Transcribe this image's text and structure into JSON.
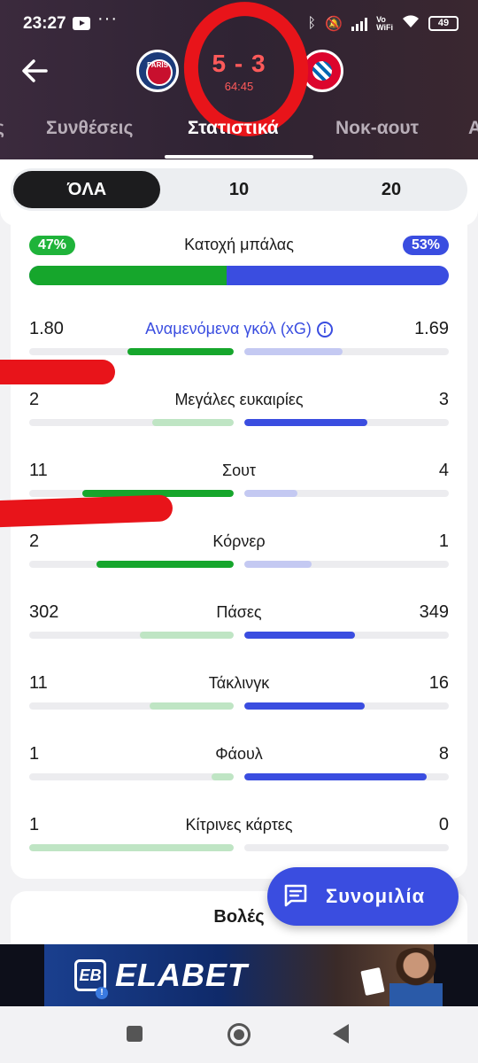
{
  "status_bar": {
    "time": "23:27",
    "volte_line1": "Vo",
    "volte_line2": "WiFi",
    "battery": "49"
  },
  "match": {
    "home_crest_text": "PARIS",
    "score": "5 - 3",
    "clock": "64:45"
  },
  "tabs": [
    {
      "label": "ς"
    },
    {
      "label": "Συνθέσεις"
    },
    {
      "label": "Στατιστικά"
    },
    {
      "label": "Νοκ-αουτ"
    },
    {
      "label": "Α"
    }
  ],
  "period_filter": {
    "options": [
      "ΌΛΑ",
      "10",
      "20"
    ],
    "selected": "ΌΛΑ"
  },
  "possession": {
    "title": "Κατοχή μπάλας",
    "home": "47%",
    "away": "53%",
    "home_fraction": 0.47
  },
  "stats": [
    {
      "label": "Αναμενόμενα γκόλ (xG)",
      "home": "1.80",
      "away": "1.69",
      "home_fill": 0.52,
      "away_fill": 0.48,
      "home_strong": true,
      "away_strong": false,
      "highlight": true
    },
    {
      "label": "Μεγάλες ευκαιρίες",
      "home": "2",
      "away": "3",
      "home_fill": 0.4,
      "away_fill": 0.6,
      "home_strong": false,
      "away_strong": true,
      "highlight": false
    },
    {
      "label": "Σουτ",
      "home": "11",
      "away": "4",
      "home_fill": 0.74,
      "away_fill": 0.26,
      "home_strong": true,
      "away_strong": false,
      "highlight": false
    },
    {
      "label": "Κόρνερ",
      "home": "2",
      "away": "1",
      "home_fill": 0.67,
      "away_fill": 0.33,
      "home_strong": true,
      "away_strong": false,
      "highlight": false
    },
    {
      "label": "Πάσες",
      "home": "302",
      "away": "349",
      "home_fill": 0.46,
      "away_fill": 0.54,
      "home_strong": false,
      "away_strong": true,
      "highlight": false
    },
    {
      "label": "Τάκλινγκ",
      "home": "11",
      "away": "16",
      "home_fill": 0.41,
      "away_fill": 0.59,
      "home_strong": false,
      "away_strong": true,
      "highlight": false
    },
    {
      "label": "Φάουλ",
      "home": "1",
      "away": "8",
      "home_fill": 0.11,
      "away_fill": 0.89,
      "home_strong": false,
      "away_strong": true,
      "highlight": false
    },
    {
      "label": "Κίτρινες κάρτες",
      "home": "1",
      "away": "0",
      "home_fill": 1.0,
      "away_fill": 0.0,
      "home_strong": false,
      "away_strong": false,
      "highlight": false
    }
  ],
  "next_section": {
    "title": "Βολές"
  },
  "chat_button": {
    "label": "Συνομιλία"
  },
  "ad": {
    "logo": "EB",
    "brand": "ELABET"
  },
  "colors": {
    "home_strong": "#16a62c",
    "home_light": "#bfe5c4",
    "away_strong": "#3a4de0",
    "away_light": "#c4c9f2"
  }
}
